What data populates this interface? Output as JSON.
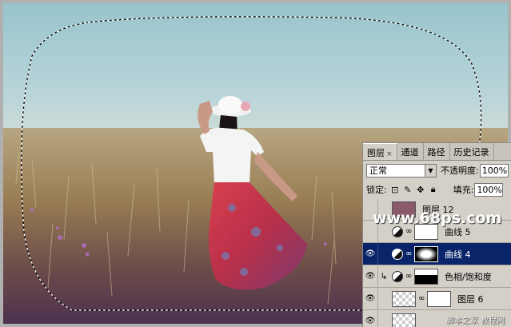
{
  "watermark": {
    "site": "www.68ps.com",
    "cn": "脚本之家 教程网"
  },
  "panel": {
    "tabs": [
      {
        "label": "图层",
        "close": "×"
      },
      {
        "label": "通道"
      },
      {
        "label": "路径"
      },
      {
        "label": "历史记录"
      }
    ],
    "blend_mode": "正常",
    "opacity_label": "不透明度:",
    "opacity_value": "100%",
    "lock_label": "锁定:",
    "fill_label": "填充:",
    "fill_value": "100%",
    "layers": [
      {
        "name": "图层 12"
      },
      {
        "name": "曲线 5"
      },
      {
        "name": "曲线 4",
        "selected": true
      },
      {
        "name": "色相/饱和度"
      },
      {
        "name": "图层 6"
      },
      {
        "name": ""
      }
    ]
  },
  "icons": {
    "eye": "eye-icon",
    "chain": "link-icon",
    "adjust": "adjustment-icon",
    "clip": "clip-arrow-icon"
  },
  "colors": {
    "selected_row": "#0a246a",
    "panel_bg": "#d4d0c8",
    "sky": "#a9cfd8",
    "skirt": "#c83a4a"
  }
}
